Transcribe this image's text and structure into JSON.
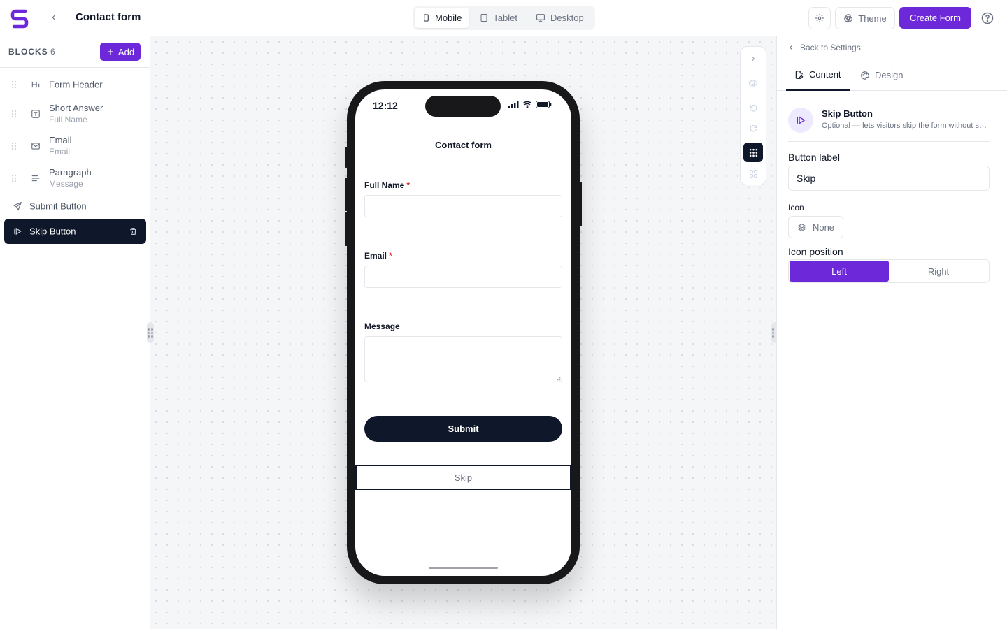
{
  "header": {
    "title": "Contact form",
    "devices": [
      {
        "label": "Mobile",
        "icon": "smartphone-icon",
        "active": true
      },
      {
        "label": "Tablet",
        "icon": "tablet-icon",
        "active": false
      },
      {
        "label": "Desktop",
        "icon": "monitor-icon",
        "active": false
      }
    ],
    "theme_label": "Theme",
    "create_label": "Create Form"
  },
  "sidebar": {
    "title": "BLOCKS",
    "count": "6",
    "add_label": "Add",
    "items": [
      {
        "label": "Form Header",
        "sub": "",
        "icon": "heading-icon"
      },
      {
        "label": "Short Answer",
        "sub": "Full Name",
        "icon": "text-field-icon"
      },
      {
        "label": "Email",
        "sub": "Email",
        "icon": "mail-icon"
      },
      {
        "label": "Paragraph",
        "sub": "Message",
        "icon": "paragraph-icon"
      },
      {
        "label": "Submit Button",
        "sub": "",
        "icon": "send-icon"
      },
      {
        "label": "Skip Button",
        "sub": "",
        "icon": "skip-icon",
        "active": true
      }
    ]
  },
  "preview": {
    "time": "12:12",
    "form_title": "Contact form",
    "fields": [
      {
        "label": "Full Name",
        "required": "*"
      },
      {
        "label": "Email",
        "required": "*"
      },
      {
        "label": "Message",
        "required": ""
      }
    ],
    "submit_label": "Submit",
    "skip_label": "Skip"
  },
  "panel": {
    "back_label": "Back to Settings",
    "tabs": [
      {
        "label": "Content",
        "active": true
      },
      {
        "label": "Design",
        "active": false
      }
    ],
    "block": {
      "title": "Skip Button",
      "description": "Optional — lets visitors skip the form without submitting"
    },
    "button_label_title": "Button label",
    "button_label_value": "Skip",
    "icon_title": "Icon",
    "icon_value": "None",
    "icon_position_title": "Icon position",
    "icon_position_options": [
      "Left",
      "Right"
    ],
    "icon_position_selected": "Left"
  },
  "colors": {
    "accent": "#6d28d9",
    "dark": "#0f172a",
    "required": "#dc2626"
  }
}
